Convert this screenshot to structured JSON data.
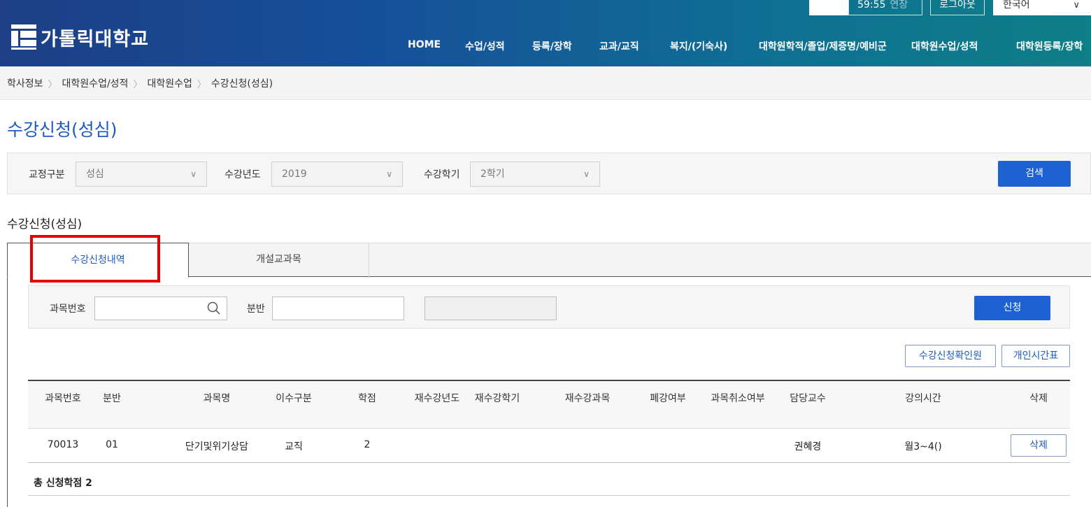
{
  "header": {
    "timer": "59:55",
    "extend_label": "연장",
    "logout_label": "로그아웃",
    "language": "한국어",
    "logo_text": "가톨릭대학교",
    "gnb": [
      "HOME",
      "수업/성적",
      "등록/장학",
      "교과/교직",
      "복지/(기숙사)",
      "대학원학적/졸업/제증명/예비군",
      "대학원수업/성적",
      "대학원등록/장학"
    ]
  },
  "breadcrumb": [
    "학사정보",
    "대학원수업/성적",
    "대학원수업",
    "수강신청(성심)"
  ],
  "page_title": "수강신청(성심)",
  "filter": {
    "campus_label": "교정구분",
    "campus_value": "성심",
    "year_label": "수강년도",
    "year_value": "2019",
    "term_label": "수강학기",
    "term_value": "2학기",
    "search_label": "검색"
  },
  "section_title": "수강신청(성심)",
  "tabs": [
    {
      "label": "수강신청내역",
      "active": true
    },
    {
      "label": "개설교과목",
      "active": false
    }
  ],
  "subfilter": {
    "course_no_label": "과목번호",
    "course_no_value": "",
    "section_label": "분반",
    "section_value": "",
    "display_value": "",
    "apply_label": "신청"
  },
  "actions": {
    "confirm_label": "수강신청확인원",
    "timetable_label": "개인시간표"
  },
  "table": {
    "headers": [
      "과목번호",
      "분반",
      "과목명",
      "이수구분",
      "학점",
      "재수강년도",
      "재수강학기",
      "재수강과목",
      "폐강여부",
      "과목취소여부",
      "담당교수",
      "강의시간",
      "삭제"
    ],
    "rows": [
      {
        "course_no": "70013",
        "section": "01",
        "title": "단기및위기상담",
        "category": "교직",
        "credit": "2",
        "retake_year": "",
        "retake_term": "",
        "retake_course": "",
        "closed": "",
        "cancelled": "",
        "professor": "권혜경",
        "time": "월3~4()",
        "delete_label": "삭제"
      }
    ]
  },
  "total_label": "총 신청학점 2",
  "colors": {
    "primary": "#1d61d3",
    "title": "#1f5bbf",
    "highlight": "#e60000"
  }
}
